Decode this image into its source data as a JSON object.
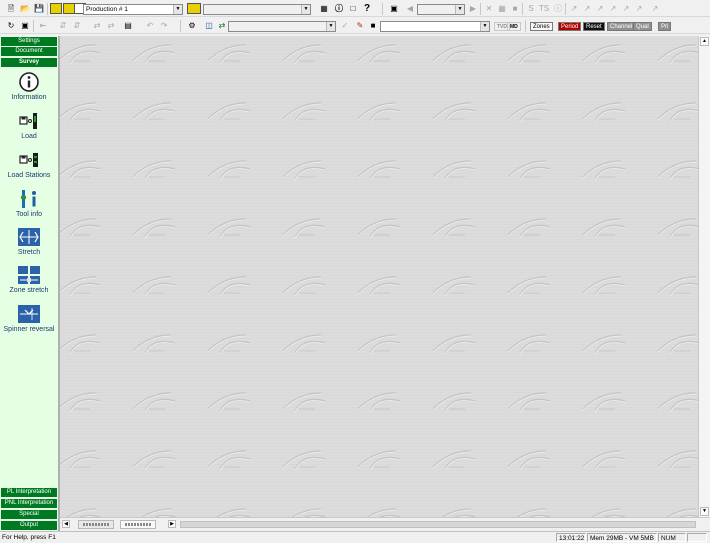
{
  "toolbar1": {
    "production_combo": "Production # 1",
    "help_glyph": "?",
    "s_label": "S",
    "ts_label": "TS"
  },
  "toolbar2": {
    "tvd_label": "TVD",
    "md_label": "MD",
    "zones_label": "Zones",
    "period_label": "Period",
    "reset_label": "Reset",
    "channel_label": "Channel",
    "qual_label": "Qual",
    "pri_label": "Pri"
  },
  "sidebar": {
    "top_tabs": [
      "Settings",
      "Document",
      "Survey"
    ],
    "active_tab": "Survey",
    "tools": [
      {
        "label": "Information",
        "icon": "information-icon"
      },
      {
        "label": "Load",
        "icon": "load-icon"
      },
      {
        "label": "Load Stations",
        "icon": "load-stations-icon"
      },
      {
        "label": "Tool info",
        "icon": "tool-info-icon"
      },
      {
        "label": "Stretch",
        "icon": "stretch-icon"
      },
      {
        "label": "Zone stretch",
        "icon": "zone-stretch-icon"
      },
      {
        "label": "Spinner reversal",
        "icon": "spinner-reversal-icon"
      }
    ],
    "bottom_tabs": [
      "PL Interpretation",
      "PNL Interpretation",
      "Special",
      "Output"
    ]
  },
  "status": {
    "help": "For Help, press F1",
    "time": "13:01:22",
    "memory": "Mem 29MB - VM 5MB",
    "num": "NUM"
  },
  "colors": {
    "sidebar_bg": "#e5ffe5",
    "tab_green": "#007a22",
    "period_red": "#b00000",
    "reset_black": "#101010"
  }
}
